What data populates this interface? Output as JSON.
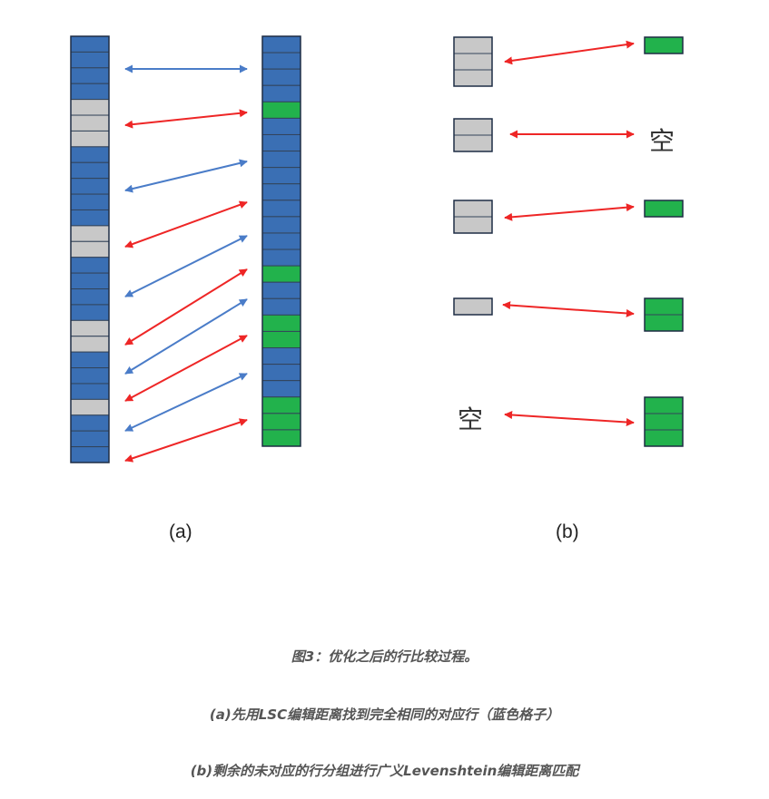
{
  "colors": {
    "blue": "#3a6fb4",
    "gray": "#c8c8c8",
    "green": "#22b24c",
    "blue_arrow": "#4a7cc8",
    "red_arrow": "#ee2626",
    "cell_border": "#33445a"
  },
  "labels": {
    "panel_a": "(a)",
    "panel_b": "(b)",
    "empty_b1": "空",
    "empty_b2": "空"
  },
  "caption": {
    "line1": "图3：优化之后的行比较过程。",
    "line2": "(a)先用LSC编辑距离找到完全相同的对应行（蓝色格子）",
    "line3": "(b)剩余的未对应的行分组进行广义Levenshtein编辑距离匹配"
  },
  "panel_a": {
    "left_column": [
      "blue",
      "blue",
      "blue",
      "blue",
      "gray",
      "gray",
      "gray",
      "blue",
      "blue",
      "blue",
      "blue",
      "blue",
      "gray",
      "gray",
      "blue",
      "blue",
      "blue",
      "blue",
      "gray",
      "gray",
      "blue",
      "blue",
      "blue",
      "gray",
      "blue",
      "blue",
      "blue"
    ],
    "right_column": [
      "blue",
      "blue",
      "blue",
      "blue",
      "green",
      "blue",
      "blue",
      "blue",
      "blue",
      "blue",
      "blue",
      "blue",
      "blue",
      "blue",
      "green",
      "blue",
      "blue",
      "green",
      "green",
      "blue",
      "blue",
      "blue",
      "green",
      "green",
      "green"
    ],
    "arrows": [
      "blue",
      "red",
      "blue",
      "red",
      "blue",
      "red",
      "blue",
      "red",
      "blue",
      "red",
      "red"
    ]
  },
  "panel_b": {
    "rows": [
      {
        "left_gray": 3,
        "right_green": 1,
        "left_empty": false,
        "right_empty": false
      },
      {
        "left_gray": 2,
        "right_green": 0,
        "left_empty": false,
        "right_empty": true
      },
      {
        "left_gray": 2,
        "right_green": 1,
        "left_empty": false,
        "right_empty": false
      },
      {
        "left_gray": 1,
        "right_green": 2,
        "left_empty": false,
        "right_empty": false
      },
      {
        "left_gray": 0,
        "right_green": 3,
        "left_empty": true,
        "right_empty": false
      }
    ]
  }
}
